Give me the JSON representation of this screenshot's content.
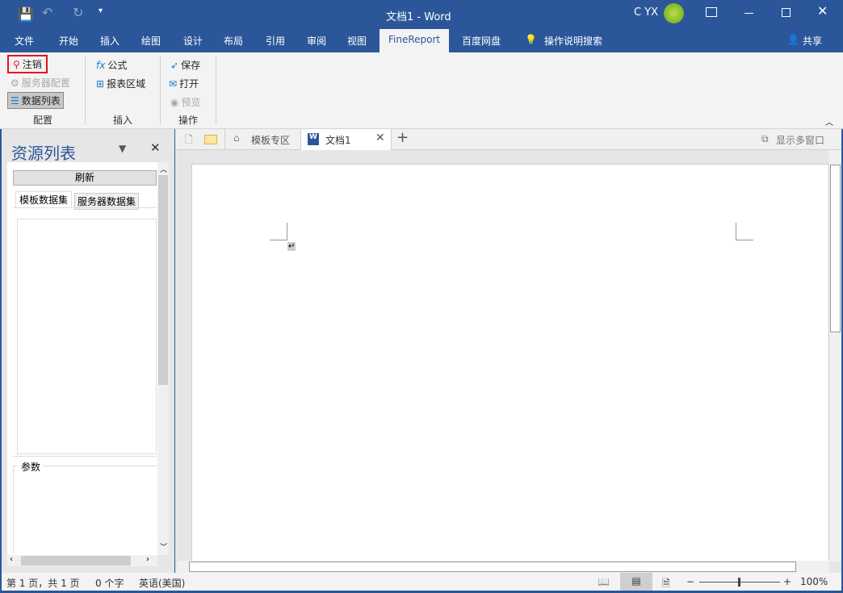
{
  "titlebar": {
    "title": "文档1 - Word",
    "user": "C YX"
  },
  "menu": [
    "文件",
    "开始",
    "插入",
    "绘图",
    "设计",
    "布局",
    "引用",
    "审阅",
    "视图",
    "FineReport",
    "百度网盘"
  ],
  "tell_me": "操作说明搜索",
  "share": "共享",
  "ribbon": {
    "groups": [
      {
        "label": "配置",
        "items": [
          "注销",
          "服务器配置",
          "数据列表"
        ]
      },
      {
        "label": "插入",
        "items": [
          "公式",
          "报表区域"
        ]
      },
      {
        "label": "操作",
        "items": [
          "保存",
          "打开",
          "预览"
        ]
      }
    ]
  },
  "panel": {
    "title": "资源列表",
    "refresh": "刷新",
    "tabs": [
      "模板数据集",
      "服务器数据集"
    ],
    "params": "参数"
  },
  "doctabs": {
    "templates": "模板专区",
    "doc": "文档1",
    "multiwindow": "显示多窗口"
  },
  "status": {
    "page": "第 1 页，共 1 页",
    "words": "0 个字",
    "lang": "英语(美国)",
    "zoom": "100%"
  },
  "colors": {
    "accent": "#2b579a",
    "highlight": "#e81123"
  }
}
